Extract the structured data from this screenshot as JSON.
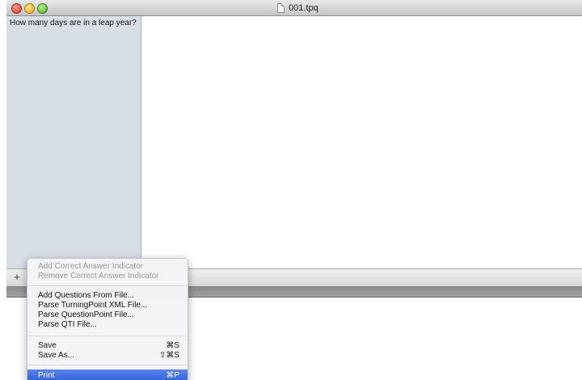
{
  "window": {
    "title": "001.tpq"
  },
  "sidebar": {
    "questions": [
      "How many days are in a leap year?"
    ]
  },
  "bottombar": {
    "add_label": "+"
  },
  "menu": {
    "group1": [
      {
        "label": "Add Correct Answer Indicator",
        "enabled": false
      },
      {
        "label": "Remove Correct Answer Indicator",
        "enabled": false
      }
    ],
    "group2": [
      {
        "label": "Add Questions From File..."
      },
      {
        "label": "Parse TurningPoint XML File..."
      },
      {
        "label": "Parse QuestionPoint File..."
      },
      {
        "label": "Parse QTI File..."
      }
    ],
    "group3": [
      {
        "label": "Save",
        "shortcut": "⌘S"
      },
      {
        "label": "Save As...",
        "shortcut": "⇧⌘S"
      }
    ],
    "print": {
      "label": "Print",
      "shortcut": "⌘P",
      "highlighted": true
    }
  }
}
